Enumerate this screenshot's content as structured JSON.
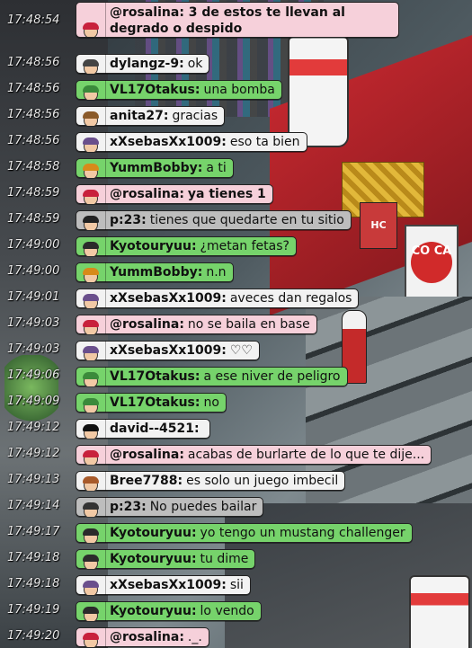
{
  "chat": {
    "messages": [
      {
        "time": "17:48:54",
        "user": "@rosalina:",
        "text": "3 de estos te llevan al degrado o despido",
        "style": "pink",
        "bold_text": true
      },
      {
        "time": "17:48:56",
        "user": "dylangz-9:",
        "text": "ok",
        "style": "light"
      },
      {
        "time": "17:48:56",
        "user": "VL17Otakus:",
        "text": "una bomba",
        "style": "green"
      },
      {
        "time": "17:48:56",
        "user": "anita27:",
        "text": "gracias",
        "style": "light"
      },
      {
        "time": "17:48:56",
        "user": "xXsebasXx1009:",
        "text": "eso ta bien",
        "style": "light"
      },
      {
        "time": "17:48:58",
        "user": "YummBobby:",
        "text": "a ti",
        "style": "green"
      },
      {
        "time": "17:48:59",
        "user": "@rosalina:",
        "text": "ya tienes 1",
        "style": "pink",
        "bold_text": true
      },
      {
        "time": "17:48:59",
        "user": "p:23:",
        "text": "tienes que quedarte en tu sitio",
        "style": "dark"
      },
      {
        "time": "17:49:00",
        "user": "Kyotouryuu:",
        "text": "¿metan fetas?",
        "style": "green"
      },
      {
        "time": "17:49:00",
        "user": "YummBobby:",
        "text": "n.n",
        "style": "green"
      },
      {
        "time": "17:49:01",
        "user": "xXsebasXx1009:",
        "text": "aveces dan regalos",
        "style": "light"
      },
      {
        "time": "17:49:03",
        "user": "@rosalina:",
        "text": "no se baila en base",
        "style": "pink"
      },
      {
        "time": "17:49:03",
        "user": "xXsebasXx1009:",
        "text": "♡♡",
        "style": "light"
      },
      {
        "time": "17:49:06",
        "user": "VL17Otakus:",
        "text": "a ese niver de peligro",
        "style": "green"
      },
      {
        "time": "17:49:09",
        "user": "VL17Otakus:",
        "text": "no",
        "style": "green"
      },
      {
        "time": "17:49:12",
        "user": "david--4521:",
        "text": "",
        "style": "light"
      },
      {
        "time": "17:49:12",
        "user": "@rosalina:",
        "text": "acabas de burlarte de lo que te dije...",
        "style": "pink"
      },
      {
        "time": "17:49:13",
        "user": "Bree7788:",
        "text": "es solo un juego imbecil",
        "style": "light"
      },
      {
        "time": "17:49:14",
        "user": "p:23:",
        "text": "No puedes bailar",
        "style": "dark"
      },
      {
        "time": "17:49:17",
        "user": "Kyotouryuu:",
        "text": "yo tengo un mustang challenger",
        "style": "green"
      },
      {
        "time": "17:49:18",
        "user": "Kyotouryuu:",
        "text": "tu dime",
        "style": "green"
      },
      {
        "time": "17:49:18",
        "user": "xXsebasXx1009:",
        "text": "sii",
        "style": "light"
      },
      {
        "time": "17:49:19",
        "user": "Kyotouryuu:",
        "text": "lo vendo",
        "style": "green"
      },
      {
        "time": "17:49:20",
        "user": "@rosalina:",
        "text": "._.",
        "style": "pink"
      }
    ]
  },
  "room": {
    "sign_text": "CO CA",
    "booth_label": "HC"
  },
  "colors": {
    "green_bubble": "#76d36b",
    "pink_bubble": "#f6d0da",
    "light_bubble": "#f2f2f2",
    "dark_bubble": "#bdbdbd"
  }
}
